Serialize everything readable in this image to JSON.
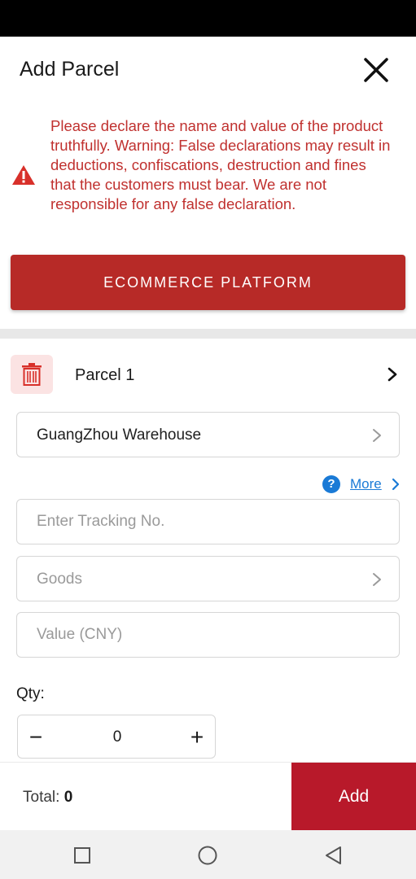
{
  "header": {
    "title": "Add Parcel",
    "close_icon": "close-icon"
  },
  "warning": {
    "icon": "warning-icon",
    "text": "Please declare the name and value of the product truthfully. Warning: False declarations may result in deductions, confiscations, destruction and fines that the customers must bear. We are not responsible for any false declaration.",
    "color": "#c0312f"
  },
  "platform_button": {
    "label": "ECOMMERCE PLATFORM",
    "color": "#b72a27"
  },
  "parcel": {
    "label": "Parcel 1",
    "delete_icon": "trash-icon"
  },
  "warehouse": {
    "value": "GuangZhou Warehouse"
  },
  "more": {
    "label": "More",
    "icon": "help-icon"
  },
  "tracking": {
    "placeholder": "Enter Tracking No."
  },
  "goods": {
    "placeholder": "Goods"
  },
  "value_field": {
    "placeholder": "Value (CNY)"
  },
  "quantity": {
    "label": "Qty:",
    "value": "0",
    "minus": "−",
    "plus": "+"
  },
  "footer": {
    "total_label": "Total:",
    "total_value": "0",
    "add_label": "Add",
    "add_color": "#b8192a"
  },
  "nav": {
    "recent_icon": "recent-apps-icon",
    "home_icon": "home-icon",
    "back_icon": "back-icon"
  },
  "colors": {
    "accent": "#b72a27",
    "link": "#1a7ad6"
  }
}
